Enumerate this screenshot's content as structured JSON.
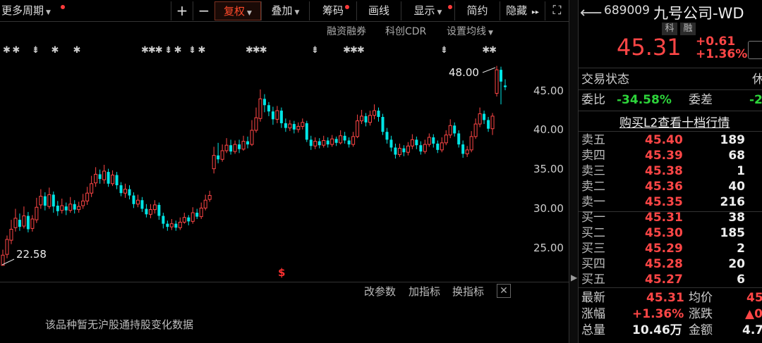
{
  "toolbar": {
    "period": "更多周期",
    "plus": "+",
    "minus": "−",
    "adjust": "复权",
    "overlay": "叠加",
    "chips": "筹码",
    "draw": "画线",
    "display": "显示",
    "simple": "简约",
    "hide": "隐藏",
    "expand_glyph": "▸▸",
    "fullscreen_glyph": "⛶"
  },
  "subbar": {
    "margin": "融资融券",
    "cdr": "科创CDR",
    "ma_settings": "设置均线"
  },
  "price_axis": [
    "45.00",
    "40.00",
    "35.00",
    "30.00",
    "25.00"
  ],
  "annotations": {
    "high": "48.00",
    "low": "22.58",
    "dollar_marker": "$"
  },
  "indicator_bar": {
    "change_params": "改参数",
    "add_indicator": "加指标",
    "switch_indicator": "换指标",
    "close": "✕"
  },
  "hk_message": "该品种暂无沪股通持股变化数据",
  "stock": {
    "code": "689009",
    "name": "九号公司-WD",
    "tag1": "科",
    "tag2": "融",
    "price": "45.31",
    "change": "+0.61",
    "change_pct": "+1.36%"
  },
  "status": {
    "label": "交易状态",
    "value": "休",
    "ratio_label": "委比",
    "ratio_value": "-34.58%",
    "diff_label": "委差",
    "diff_value": "-2"
  },
  "book_banner": "购买L2查看十档行情",
  "asks": [
    {
      "label": "卖五",
      "price": "45.40",
      "vol": "189"
    },
    {
      "label": "卖四",
      "price": "45.39",
      "vol": "68"
    },
    {
      "label": "卖三",
      "price": "45.38",
      "vol": "1"
    },
    {
      "label": "卖二",
      "price": "45.36",
      "vol": "40"
    },
    {
      "label": "卖一",
      "price": "45.35",
      "vol": "216"
    }
  ],
  "bids": [
    {
      "label": "买一",
      "price": "45.31",
      "vol": "38"
    },
    {
      "label": "买二",
      "price": "45.30",
      "vol": "185"
    },
    {
      "label": "买三",
      "price": "45.29",
      "vol": "2"
    },
    {
      "label": "买四",
      "price": "45.28",
      "vol": "20"
    },
    {
      "label": "买五",
      "price": "45.27",
      "vol": "6"
    }
  ],
  "summary": {
    "latest_label": "最新",
    "latest": "45.31",
    "avg_label": "均价",
    "avg": "45",
    "pct_label": "涨幅",
    "pct": "+1.36%",
    "chg_label": "涨跌",
    "chg": "▲0",
    "vol_label": "总量",
    "vol": "10.46万",
    "amt_label": "金额",
    "amt": "4.7"
  },
  "colors": {
    "up": "#ff4646",
    "down": "#00e5e5",
    "green": "#2dd43a",
    "bg": "#000000"
  },
  "chart_data": {
    "type": "candlestick",
    "ylim": [
      20.9,
      50.8
    ],
    "y_ticks": [
      25,
      30,
      35,
      40,
      45
    ],
    "candles": [
      [
        22.6,
        23.9,
        24.6,
        22.58
      ],
      [
        24.0,
        25.9,
        26.4,
        23.5
      ],
      [
        25.8,
        27.2,
        28.4,
        25.3
      ],
      [
        27.4,
        28.6,
        29.8,
        26.9
      ],
      [
        28.4,
        27.5,
        29.2,
        27.0
      ],
      [
        27.6,
        28.9,
        30.1,
        27.3
      ],
      [
        28.9,
        27.2,
        29.4,
        26.8
      ],
      [
        27.3,
        28.5,
        29.0,
        26.9
      ],
      [
        28.4,
        30.0,
        31.2,
        28.0
      ],
      [
        30.3,
        31.4,
        32.3,
        29.8
      ],
      [
        31.4,
        30.2,
        31.9,
        29.6
      ],
      [
        30.1,
        31.6,
        32.5,
        29.8
      ],
      [
        31.6,
        30.1,
        32.0,
        29.3
      ],
      [
        30.2,
        29.5,
        30.8,
        28.9
      ],
      [
        29.6,
        30.2,
        31.1,
        29.2
      ],
      [
        30.1,
        29.6,
        30.6,
        29.0
      ],
      [
        29.6,
        30.4,
        31.3,
        29.3
      ],
      [
        30.4,
        29.7,
        30.9,
        29.2
      ],
      [
        29.7,
        30.1,
        30.7,
        29.3
      ],
      [
        30.2,
        30.8,
        31.7,
        29.8
      ],
      [
        30.8,
        31.8,
        32.6,
        30.3
      ],
      [
        31.8,
        33.0,
        34.0,
        31.3
      ],
      [
        33.1,
        34.2,
        35.1,
        32.6
      ],
      [
        34.2,
        33.6,
        34.8,
        33.0
      ],
      [
        33.5,
        34.6,
        35.4,
        33.0
      ],
      [
        34.5,
        33.0,
        34.9,
        32.6
      ],
      [
        33.0,
        34.1,
        34.7,
        32.7
      ],
      [
        34.1,
        32.8,
        34.5,
        32.3
      ],
      [
        32.8,
        31.8,
        33.2,
        31.4
      ],
      [
        31.8,
        32.3,
        33.0,
        31.2
      ],
      [
        32.3,
        31.5,
        32.8,
        31.0
      ],
      [
        31.5,
        30.4,
        31.9,
        29.9
      ],
      [
        30.4,
        30.9,
        31.6,
        30.0
      ],
      [
        30.9,
        29.8,
        31.3,
        29.4
      ],
      [
        29.8,
        29.1,
        30.4,
        28.7
      ],
      [
        29.1,
        29.7,
        30.4,
        28.6
      ],
      [
        29.7,
        30.3,
        30.9,
        29.2
      ],
      [
        30.3,
        28.9,
        30.6,
        28.4
      ],
      [
        28.9,
        27.9,
        29.3,
        27.3
      ],
      [
        27.9,
        27.5,
        28.3,
        27.0
      ],
      [
        27.5,
        27.9,
        28.5,
        27.1
      ],
      [
        27.9,
        27.4,
        28.3,
        27.0
      ],
      [
        27.4,
        28.1,
        28.7,
        27.1
      ],
      [
        28.1,
        28.7,
        29.3,
        27.9
      ],
      [
        28.7,
        28.2,
        29.0,
        27.7
      ],
      [
        28.2,
        29.3,
        30.0,
        27.9
      ],
      [
        29.3,
        28.8,
        29.8,
        28.5
      ],
      [
        28.8,
        29.9,
        30.6,
        28.5
      ],
      [
        29.9,
        30.9,
        31.6,
        29.6
      ],
      [
        31.0,
        31.5,
        32.1,
        30.7
      ],
      [
        34.9,
        36.6,
        37.7,
        34.3
      ],
      [
        36.6,
        36.1,
        38.2,
        35.6
      ],
      [
        36.1,
        37.2,
        38.0,
        35.8
      ],
      [
        37.2,
        37.9,
        38.8,
        36.9
      ],
      [
        37.9,
        37.1,
        38.6,
        36.7
      ],
      [
        37.1,
        38.0,
        38.5,
        36.8
      ],
      [
        38.0,
        37.4,
        38.6,
        36.9
      ],
      [
        37.4,
        38.4,
        39.1,
        37.2
      ],
      [
        38.4,
        38.0,
        39.0,
        37.5
      ],
      [
        38.0,
        39.8,
        41.1,
        37.8
      ],
      [
        39.8,
        41.4,
        42.7,
        39.5
      ],
      [
        41.3,
        43.8,
        45.0,
        40.9
      ],
      [
        43.8,
        43.0,
        44.4,
        42.1
      ],
      [
        43.0,
        42.2,
        43.4,
        41.6
      ],
      [
        42.2,
        41.2,
        42.8,
        40.5
      ],
      [
        41.2,
        42.3,
        42.9,
        40.7
      ],
      [
        42.3,
        40.7,
        42.7,
        40.1
      ],
      [
        40.7,
        40.1,
        41.3,
        39.6
      ],
      [
        40.1,
        40.6,
        41.1,
        39.7
      ],
      [
        40.6,
        39.9,
        41.0,
        39.4
      ],
      [
        39.9,
        40.3,
        40.8,
        39.5
      ],
      [
        40.3,
        40.8,
        41.3,
        39.9
      ],
      [
        40.7,
        38.6,
        41.0,
        38.3
      ],
      [
        38.6,
        37.8,
        39.1,
        37.3
      ],
      [
        37.8,
        38.4,
        38.9,
        37.4
      ],
      [
        38.4,
        37.9,
        38.8,
        37.5
      ],
      [
        37.9,
        38.5,
        39.1,
        37.6
      ],
      [
        38.5,
        38.0,
        38.9,
        37.6
      ],
      [
        38.0,
        38.7,
        39.2,
        37.7
      ],
      [
        38.7,
        38.2,
        39.0,
        37.8
      ],
      [
        38.2,
        39.1,
        39.8,
        38.0
      ],
      [
        39.1,
        38.5,
        39.6,
        38.1
      ],
      [
        38.5,
        38.0,
        38.9,
        37.6
      ],
      [
        38.0,
        39.0,
        39.6,
        37.7
      ],
      [
        39.0,
        41.0,
        41.8,
        38.8
      ],
      [
        41.0,
        41.6,
        42.4,
        40.6
      ],
      [
        41.6,
        40.8,
        42.0,
        40.3
      ],
      [
        40.8,
        41.7,
        42.3,
        40.4
      ],
      [
        41.7,
        42.3,
        43.1,
        41.2
      ],
      [
        42.3,
        41.5,
        42.7,
        40.9
      ],
      [
        41.5,
        39.6,
        41.9,
        39.2
      ],
      [
        39.6,
        38.6,
        40.1,
        38.1
      ],
      [
        38.6,
        37.6,
        39.1,
        37.1
      ],
      [
        37.6,
        36.7,
        38.1,
        36.2
      ],
      [
        36.7,
        37.5,
        38.1,
        36.4
      ],
      [
        37.5,
        37.0,
        37.9,
        36.5
      ],
      [
        37.0,
        37.8,
        38.3,
        36.6
      ],
      [
        37.8,
        38.6,
        39.3,
        37.4
      ],
      [
        38.6,
        37.9,
        39.0,
        37.4
      ],
      [
        37.9,
        37.1,
        38.4,
        36.7
      ],
      [
        37.1,
        38.0,
        38.6,
        36.8
      ],
      [
        38.0,
        38.9,
        39.4,
        37.7
      ],
      [
        38.9,
        38.1,
        39.3,
        37.6
      ],
      [
        38.1,
        37.3,
        38.5,
        36.9
      ],
      [
        37.3,
        38.2,
        38.9,
        37.0
      ],
      [
        38.2,
        39.2,
        39.8,
        37.9
      ],
      [
        39.2,
        40.4,
        41.2,
        38.8
      ],
      [
        40.4,
        39.4,
        40.8,
        39.0
      ],
      [
        39.4,
        38.0,
        39.8,
        37.6
      ],
      [
        38.0,
        36.8,
        38.5,
        36.3
      ],
      [
        36.8,
        37.3,
        37.8,
        36.4
      ],
      [
        37.3,
        39.0,
        39.7,
        37.0
      ],
      [
        39.0,
        40.6,
        41.3,
        38.7
      ],
      [
        40.6,
        41.9,
        42.7,
        40.2
      ],
      [
        41.9,
        41.1,
        42.3,
        40.6
      ],
      [
        41.1,
        40.0,
        41.5,
        39.6
      ],
      [
        40.0,
        41.6,
        42.0,
        39.2
      ],
      [
        44.5,
        47.5,
        48.0,
        44.1
      ],
      [
        47.5,
        46.0,
        47.9,
        43.1
      ],
      [
        45.5,
        45.3,
        46.3,
        44.9
      ]
    ]
  }
}
